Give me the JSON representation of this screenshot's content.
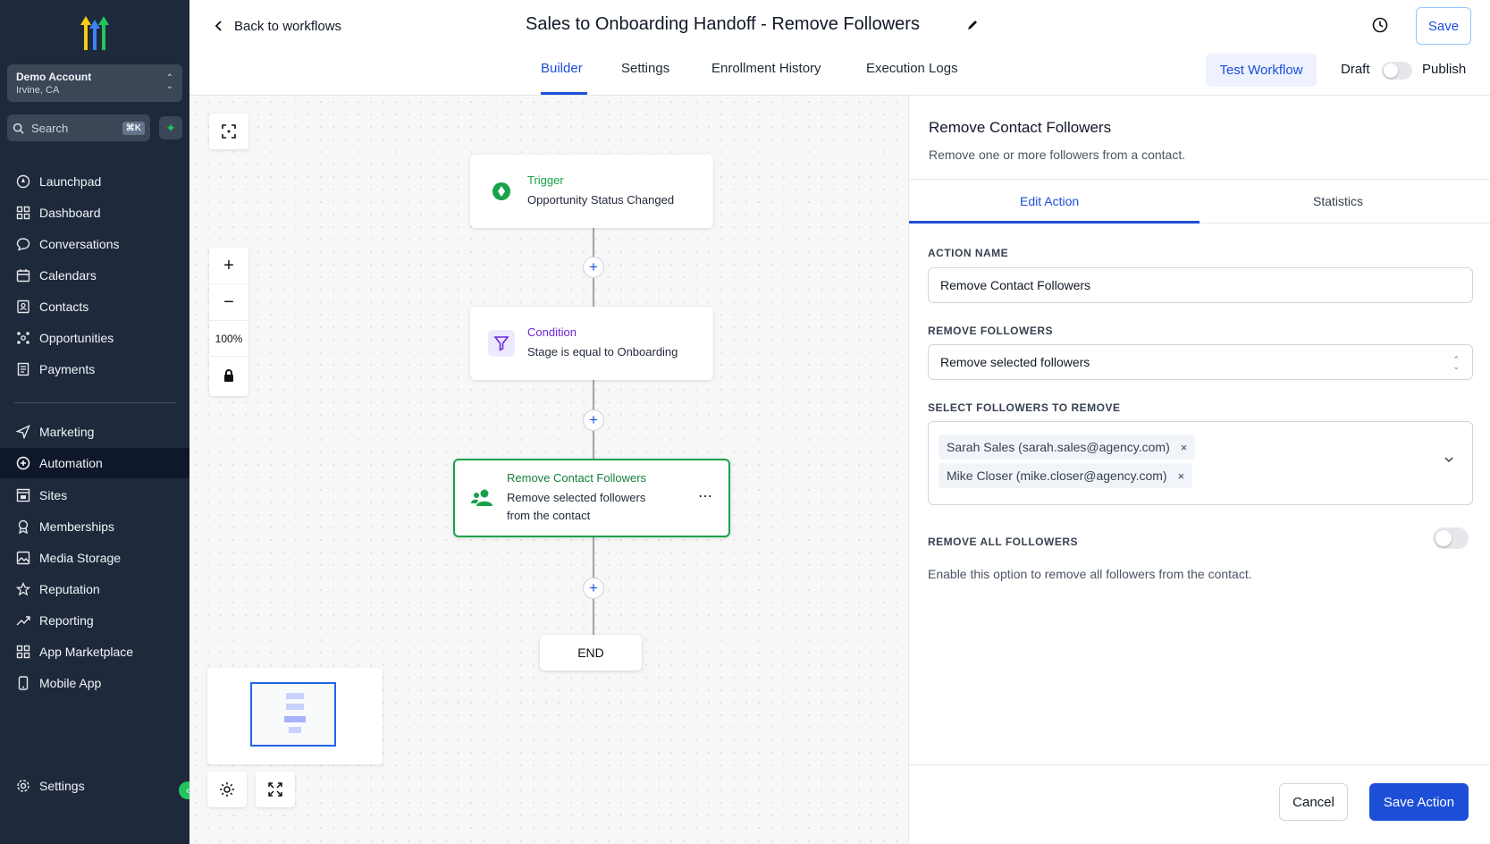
{
  "sidebar": {
    "account_name": "Demo Account",
    "account_location": "Irvine, CA",
    "search_placeholder": "Search",
    "search_shortcut": "⌘K",
    "items": [
      {
        "label": "Launchpad",
        "icon": "launchpad-icon"
      },
      {
        "label": "Dashboard",
        "icon": "dashboard-icon"
      },
      {
        "label": "Conversations",
        "icon": "chat-icon"
      },
      {
        "label": "Calendars",
        "icon": "calendar-icon"
      },
      {
        "label": "Contacts",
        "icon": "contacts-icon"
      },
      {
        "label": "Opportunities",
        "icon": "opportunities-icon"
      },
      {
        "label": "Payments",
        "icon": "payments-icon"
      },
      {
        "label": "Marketing",
        "icon": "send-icon"
      },
      {
        "label": "Automation",
        "icon": "automation-icon",
        "active": true
      },
      {
        "label": "Sites",
        "icon": "sites-icon"
      },
      {
        "label": "Memberships",
        "icon": "memberships-icon"
      },
      {
        "label": "Media Storage",
        "icon": "image-icon"
      },
      {
        "label": "Reputation",
        "icon": "star-icon"
      },
      {
        "label": "Reporting",
        "icon": "trend-icon"
      },
      {
        "label": "App Marketplace",
        "icon": "grid-icon"
      },
      {
        "label": "Mobile App",
        "icon": "phone-icon"
      }
    ],
    "settings_label": "Settings"
  },
  "header": {
    "back_label": "Back to workflows",
    "title": "Sales to Onboarding Handoff - Remove Followers",
    "save_label": "Save",
    "tabs": [
      {
        "label": "Builder",
        "active": true
      },
      {
        "label": "Settings"
      },
      {
        "label": "Enrollment History"
      },
      {
        "label": "Execution Logs"
      }
    ],
    "test_label": "Test Workflow",
    "draft_label": "Draft",
    "publish_label": "Publish",
    "published": false
  },
  "canvas": {
    "zoom": "100%",
    "nodes": {
      "trigger": {
        "type": "Trigger",
        "text": "Opportunity Status Changed"
      },
      "condition": {
        "type": "Condition",
        "text": "Stage is equal to Onboarding"
      },
      "action": {
        "type": "Remove Contact Followers",
        "text1": "Remove selected followers",
        "text2": "from the contact",
        "more": "⋯"
      },
      "end": "END"
    }
  },
  "panel": {
    "title": "Remove Contact Followers",
    "subtitle": "Remove one or more followers from a contact.",
    "tabs": [
      {
        "label": "Edit Action",
        "active": true
      },
      {
        "label": "Statistics"
      }
    ],
    "action_name_label": "ACTION NAME",
    "action_name_value": "Remove Contact Followers",
    "remove_followers_label": "REMOVE FOLLOWERS",
    "remove_followers_value": "Remove selected followers",
    "select_label": "SELECT FOLLOWERS TO REMOVE",
    "followers": [
      "Sarah Sales (sarah.sales@agency.com)",
      "Mike Closer (mike.closer@agency.com)"
    ],
    "chip_remove": "×",
    "remove_all_label": "REMOVE ALL FOLLOWERS",
    "remove_all_enabled": false,
    "remove_all_hint": "Enable this option to remove all followers from the contact.",
    "cancel_label": "Cancel",
    "save_action_label": "Save Action"
  },
  "colors": {
    "sidebar": "#1e293b",
    "accent": "#1d4ed8",
    "success": "#16a34a",
    "condition": "#6d28d9"
  }
}
